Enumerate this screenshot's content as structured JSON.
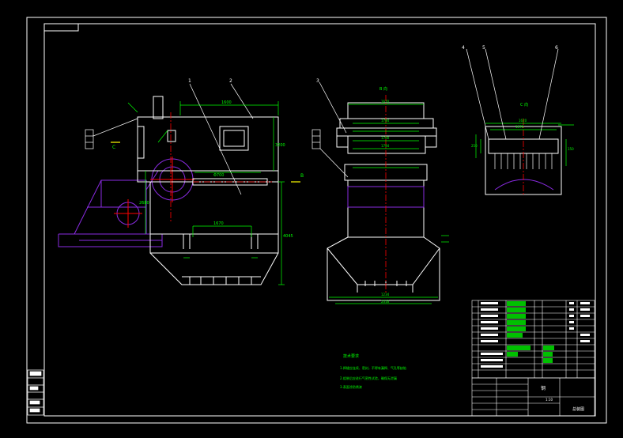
{
  "colors": {
    "background": "#000000",
    "outline": "#ffffff",
    "dimension": "#00ff00",
    "center_line": "#ff0000",
    "hidden_part": "#8a2be2",
    "leader": "#ffff00",
    "title_block_fill": "#00c000"
  },
  "drawing": {
    "section_marks": {
      "b": "B",
      "c": "C"
    },
    "view_titles": {
      "b_view": "B 向",
      "c_view": "C 向"
    },
    "part_numbers": {
      "p1": "1",
      "p2": "2",
      "p3": "3",
      "p4": "4",
      "p5": "5",
      "p6": "6"
    },
    "front_view": {
      "dims": {
        "top_width": "1600",
        "inner_width": "1670",
        "flange": "Φ700",
        "height1": "4045",
        "height2": "3200",
        "lower": "2680"
      }
    },
    "side_view": {
      "dims": {
        "top": "1670",
        "d1": "1784",
        "d2": "1700",
        "d3": "1784",
        "bottom": "1234",
        "base": "2316"
      }
    },
    "c_view": {
      "dims": {
        "top": "1620",
        "inner": "1570",
        "side1": "250",
        "side2": "150"
      }
    },
    "notes": {
      "title": "技术要求",
      "line1": "1.焊缝应连续、密封，不得有漏焊、气孔等缺陷",
      "line2": "2.组装后应进行气密性试验，确保无泄漏",
      "line3": "3.表面涂防锈漆"
    },
    "title_block": {
      "material": "钢",
      "drawing_name": "总装图",
      "scale": "1:10"
    }
  }
}
